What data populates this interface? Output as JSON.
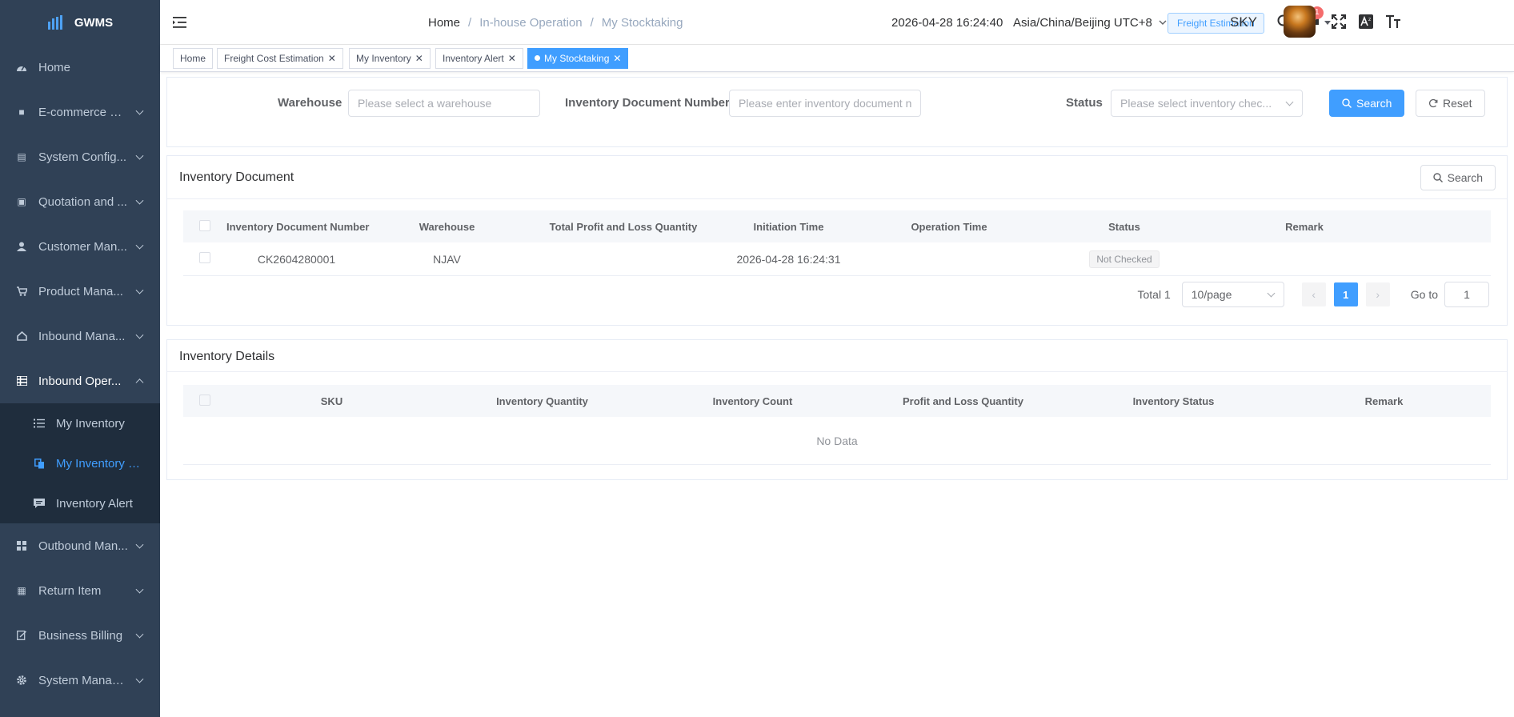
{
  "app": {
    "name": "GWMS"
  },
  "sidebar": {
    "items": [
      {
        "label": "Home"
      },
      {
        "label": "E-commerce Pl..."
      },
      {
        "label": "System Config..."
      },
      {
        "label": "Quotation and ..."
      },
      {
        "label": "Customer Man..."
      },
      {
        "label": "Product Mana..."
      },
      {
        "label": "Inbound Mana..."
      },
      {
        "label": "Inbound Oper..."
      },
      {
        "label": "Outbound Man..."
      },
      {
        "label": "Return Item"
      },
      {
        "label": "Business Billing"
      },
      {
        "label": "System Manag..."
      }
    ],
    "submenu": [
      {
        "label": "My Inventory"
      },
      {
        "label": "My Inventory C..."
      },
      {
        "label": "Inventory Alert"
      }
    ]
  },
  "header": {
    "breadcrumb": [
      "Home",
      "/",
      "In-house Operation",
      "/",
      "My Stocktaking"
    ],
    "datetime": "2026-04-28 16:24:40",
    "timezone": "Asia/China/Beijing UTC+8",
    "freight_button": "Freight Estimation",
    "notification_count": "1",
    "user": "SKY"
  },
  "tags": [
    {
      "label": "Home"
    },
    {
      "label": "Freight Cost Estimation"
    },
    {
      "label": "My Inventory"
    },
    {
      "label": "Inventory Alert"
    },
    {
      "label": "My Stocktaking"
    }
  ],
  "search": {
    "warehouse_label": "Warehouse",
    "warehouse_placeholder": "Please select a warehouse",
    "docnum_label": "Inventory Document Number",
    "docnum_placeholder": "Please enter inventory document n",
    "status_label": "Status",
    "status_placeholder": "Please select inventory chec...",
    "search_button": "Search",
    "reset_button": "Reset"
  },
  "document": {
    "title": "Inventory Document",
    "search_button": "Search",
    "columns": [
      "Inventory Document Number",
      "Warehouse",
      "Total Profit and Loss Quantity",
      "Initiation Time",
      "Operation Time",
      "Status",
      "Remark"
    ],
    "rows": [
      {
        "number": "CK2604280001",
        "warehouse": "NJAV",
        "total_pl": "",
        "initiation": "2026-04-28 16:24:31",
        "operation": "",
        "status": "Not Checked",
        "remark": ""
      }
    ],
    "pager": {
      "total": "Total 1",
      "page_size": "10/page",
      "current": "1",
      "goto_label": "Go to",
      "goto_value": "1"
    }
  },
  "details": {
    "title": "Inventory Details",
    "columns": [
      "SKU",
      "Inventory Quantity",
      "Inventory Count",
      "Profit and Loss Quantity",
      "Inventory Status",
      "Remark"
    ],
    "empty_text": "No Data"
  }
}
